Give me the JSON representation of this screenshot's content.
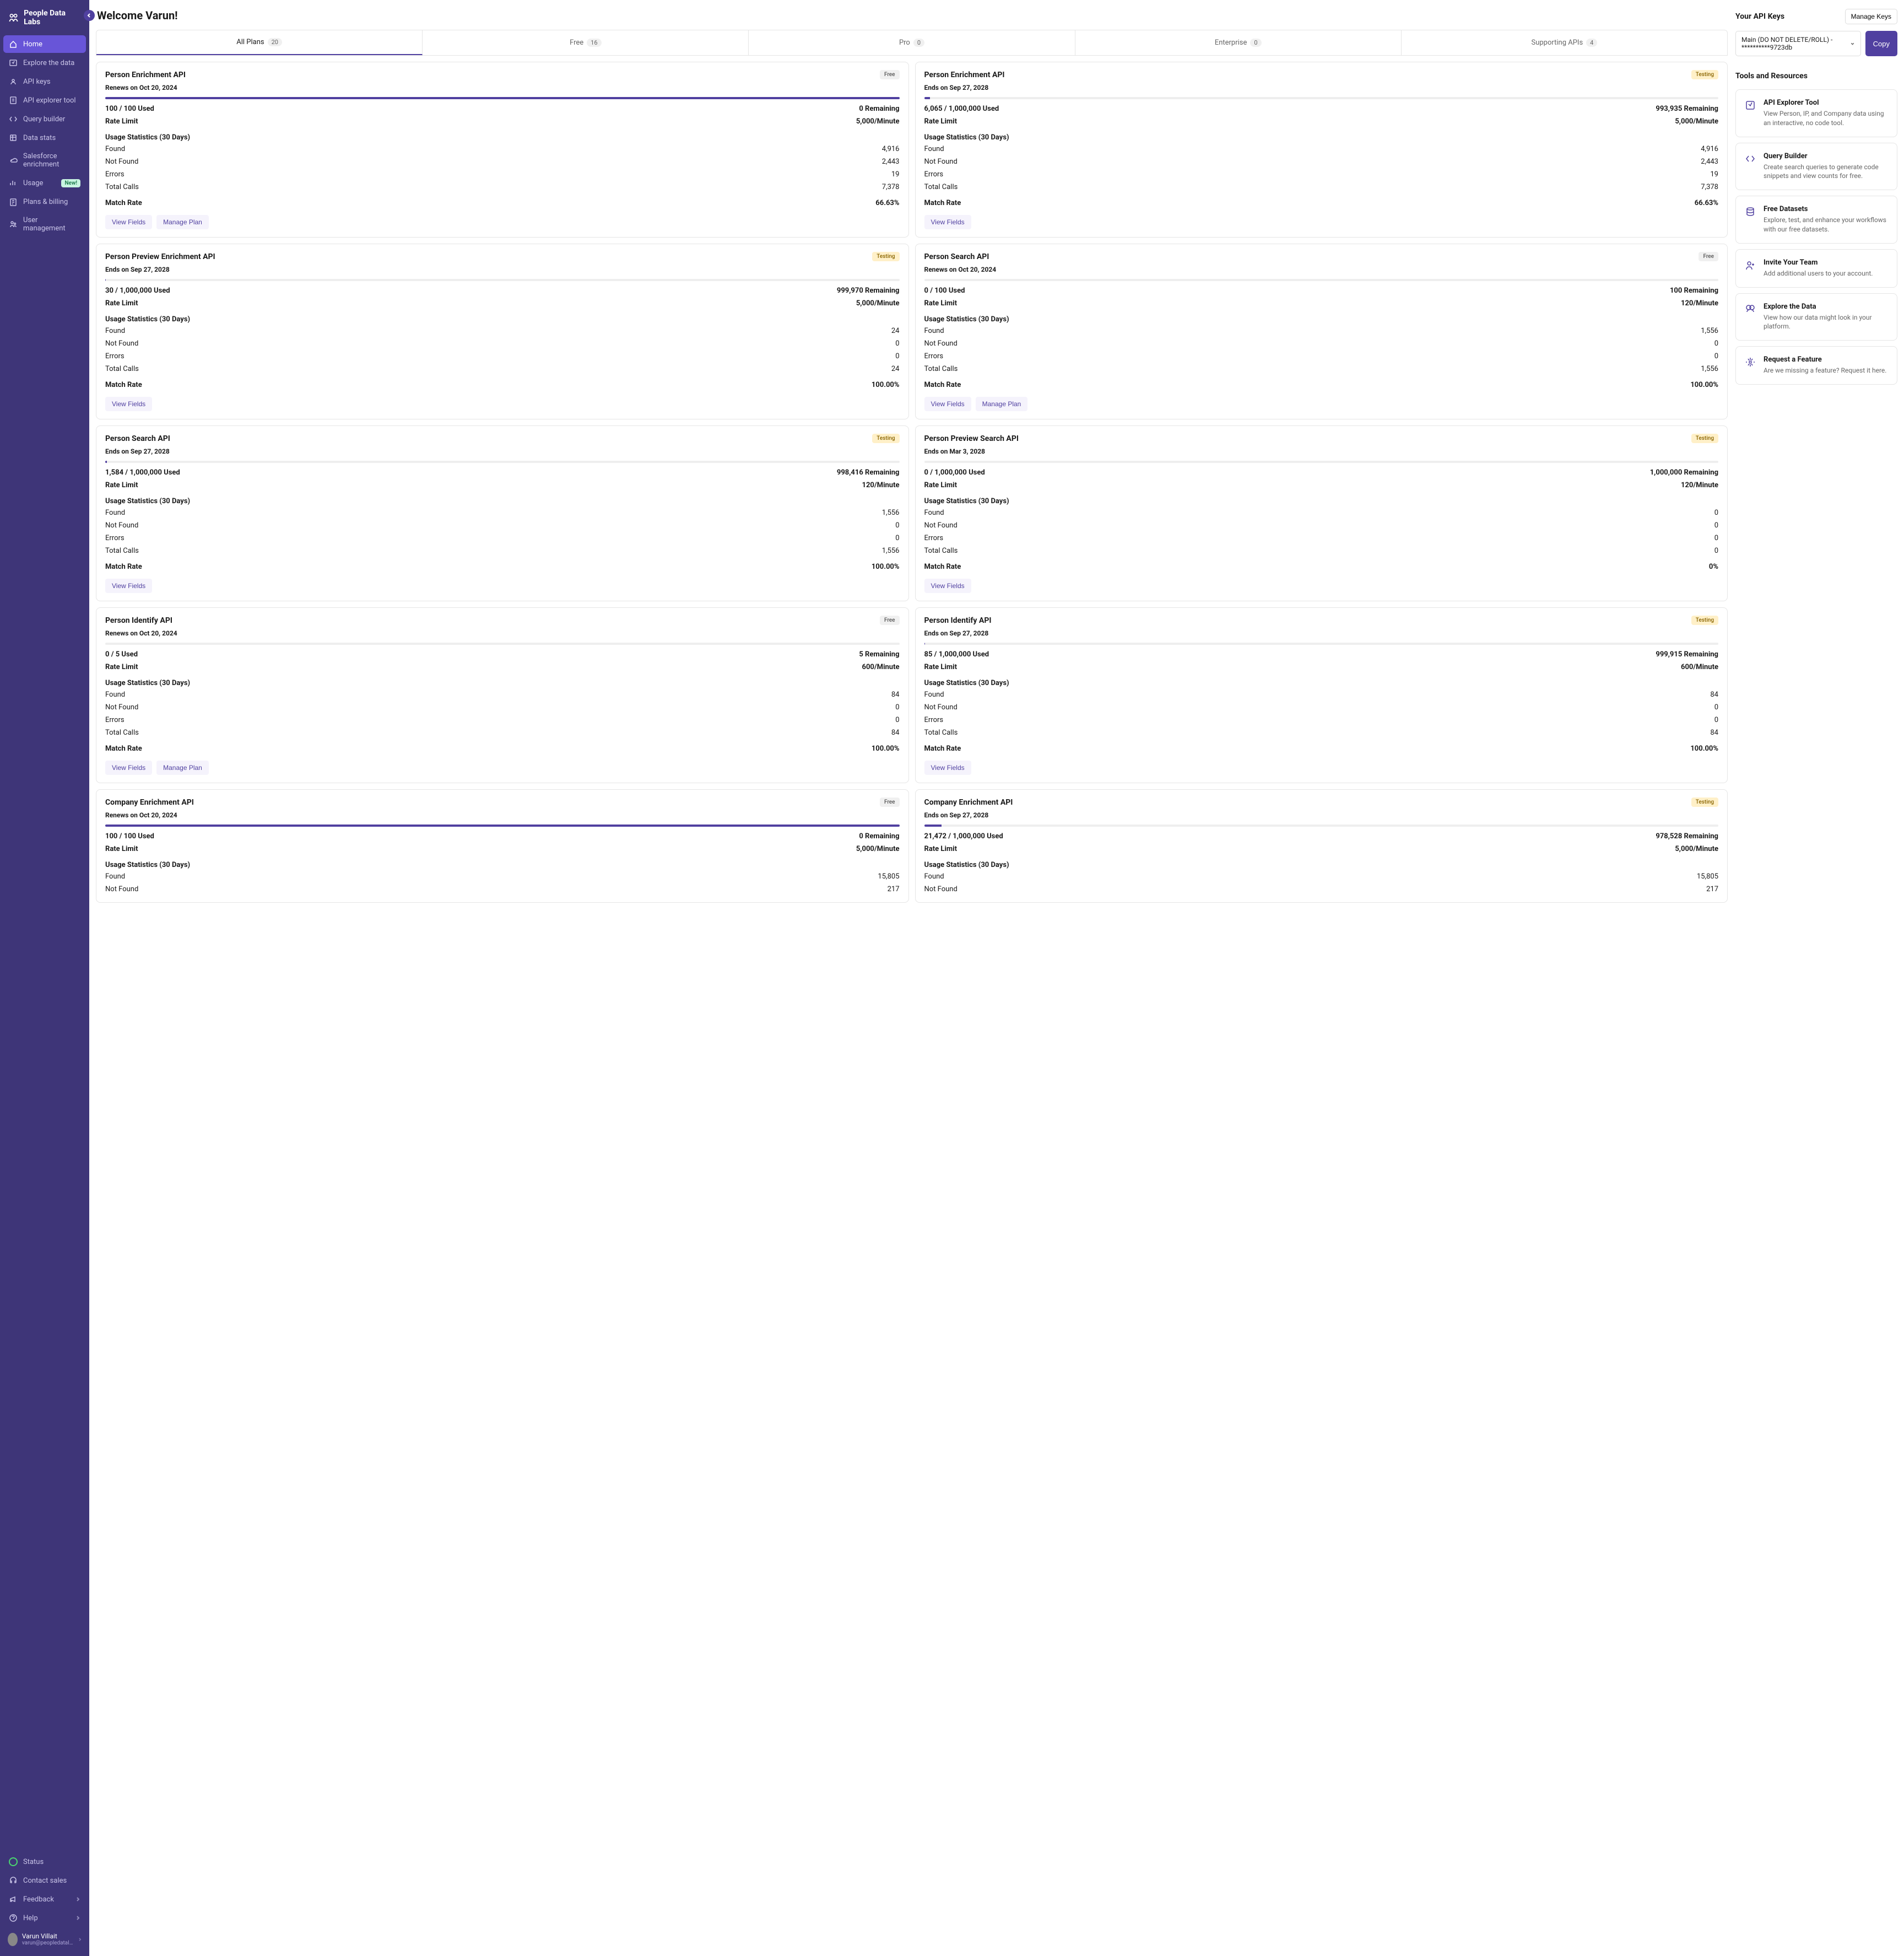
{
  "brand": "People Data Labs",
  "welcome": "Welcome Varun!",
  "sidebar": {
    "nav": [
      {
        "label": "Home",
        "active": true
      },
      {
        "label": "Explore the data"
      },
      {
        "label": "API keys"
      },
      {
        "label": "API explorer tool"
      },
      {
        "label": "Query builder"
      },
      {
        "label": "Data stats"
      },
      {
        "label": "Salesforce enrichment"
      },
      {
        "label": "Usage",
        "badge": "New!"
      },
      {
        "label": "Plans & billing"
      },
      {
        "label": "User management"
      }
    ],
    "footer": [
      {
        "label": "Status"
      },
      {
        "label": "Contact sales"
      },
      {
        "label": "Feedback",
        "chevron": true
      },
      {
        "label": "Help",
        "chevron": true
      }
    ],
    "user": {
      "name": "Varun Villait",
      "email": "varun@peopledatalabs.com"
    }
  },
  "tabs": [
    {
      "label": "All Plans",
      "count": "20",
      "active": true
    },
    {
      "label": "Free",
      "count": "16"
    },
    {
      "label": "Pro",
      "count": "0"
    },
    {
      "label": "Enterprise",
      "count": "0"
    },
    {
      "label": "Supporting APIs",
      "count": "4"
    }
  ],
  "labels": {
    "rate_limit": "Rate Limit",
    "usage_stats": "Usage Statistics (30 Days)",
    "found": "Found",
    "not_found": "Not Found",
    "errors": "Errors",
    "total_calls": "Total Calls",
    "match_rate": "Match Rate",
    "view_fields": "View Fields",
    "manage_plan": "Manage Plan"
  },
  "cards": [
    {
      "title": "Person Enrichment API",
      "badge": "Free",
      "renew": "Renews on Oct 20, 2024",
      "progress": 100,
      "used": "100 / 100 Used",
      "remaining": "0 Remaining",
      "rate": "5,000/Minute",
      "found": "4,916",
      "not_found": "2,443",
      "errors": "19",
      "total": "7,378",
      "match": "66.63%",
      "actions": [
        "view",
        "manage"
      ]
    },
    {
      "title": "Person Enrichment API",
      "badge": "Testing",
      "renew": "Ends on Sep 27, 2028",
      "progress": 0.7,
      "used": "6,065 / 1,000,000 Used",
      "remaining": "993,935 Remaining",
      "rate": "5,000/Minute",
      "found": "4,916",
      "not_found": "2,443",
      "errors": "19",
      "total": "7,378",
      "match": "66.63%",
      "actions": [
        "view"
      ]
    },
    {
      "title": "Person Preview Enrichment API",
      "badge": "Testing",
      "renew": "Ends on Sep 27, 2028",
      "progress": 0.1,
      "used": "30 / 1,000,000 Used",
      "remaining": "999,970 Remaining",
      "rate": "5,000/Minute",
      "found": "24",
      "not_found": "0",
      "errors": "0",
      "total": "24",
      "match": "100.00%",
      "actions": [
        "view"
      ]
    },
    {
      "title": "Person Search API",
      "badge": "Free",
      "renew": "Renews on Oct 20, 2024",
      "progress": 0,
      "used": "0 / 100 Used",
      "remaining": "100 Remaining",
      "rate": "120/Minute",
      "found": "1,556",
      "not_found": "0",
      "errors": "0",
      "total": "1,556",
      "match": "100.00%",
      "actions": [
        "view",
        "manage"
      ]
    },
    {
      "title": "Person Search API",
      "badge": "Testing",
      "renew": "Ends on Sep 27, 2028",
      "progress": 0.2,
      "used": "1,584 / 1,000,000 Used",
      "remaining": "998,416 Remaining",
      "rate": "120/Minute",
      "found": "1,556",
      "not_found": "0",
      "errors": "0",
      "total": "1,556",
      "match": "100.00%",
      "actions": [
        "view"
      ]
    },
    {
      "title": "Person Preview Search API",
      "badge": "Testing",
      "renew": "Ends on Mar 3, 2028",
      "progress": 0,
      "used": "0 / 1,000,000 Used",
      "remaining": "1,000,000 Remaining",
      "rate": "120/Minute",
      "found": "0",
      "not_found": "0",
      "errors": "0",
      "total": "0",
      "match": "0%",
      "actions": [
        "view"
      ]
    },
    {
      "title": "Person Identify API",
      "badge": "Free",
      "renew": "Renews on Oct 20, 2024",
      "progress": 0,
      "used": "0 / 5 Used",
      "remaining": "5 Remaining",
      "rate": "600/Minute",
      "found": "84",
      "not_found": "0",
      "errors": "0",
      "total": "84",
      "match": "100.00%",
      "actions": [
        "view",
        "manage"
      ]
    },
    {
      "title": "Person Identify API",
      "badge": "Testing",
      "renew": "Ends on Sep 27, 2028",
      "progress": 0.1,
      "used": "85 / 1,000,000 Used",
      "remaining": "999,915 Remaining",
      "rate": "600/Minute",
      "found": "84",
      "not_found": "0",
      "errors": "0",
      "total": "84",
      "match": "100.00%",
      "actions": [
        "view"
      ]
    },
    {
      "title": "Company Enrichment API",
      "badge": "Free",
      "renew": "Renews on Oct 20, 2024",
      "progress": 100,
      "used": "100 / 100 Used",
      "remaining": "0 Remaining",
      "rate": "5,000/Minute",
      "found": "15,805",
      "not_found": "217",
      "errors": "",
      "total": "",
      "match": "",
      "actions": [],
      "truncated": true
    },
    {
      "title": "Company Enrichment API",
      "badge": "Testing",
      "renew": "Ends on Sep 27, 2028",
      "progress": 2.2,
      "used": "21,472 / 1,000,000 Used",
      "remaining": "978,528 Remaining",
      "rate": "5,000/Minute",
      "found": "15,805",
      "not_found": "217",
      "errors": "",
      "total": "",
      "match": "",
      "actions": [],
      "truncated": true
    }
  ],
  "api_keys": {
    "title": "Your API Keys",
    "manage": "Manage Keys",
    "selected": "Main (DO NOT DELETE/ROLL) - **********9723db",
    "copy": "Copy"
  },
  "resources_title": "Tools and Resources",
  "resources": [
    {
      "title": "API Explorer Tool",
      "desc": "View Person, IP, and Company data using an interactive, no code tool."
    },
    {
      "title": "Query Builder",
      "desc": "Create search queries to generate code snippets and view counts for free."
    },
    {
      "title": "Free Datasets",
      "desc": "Explore, test, and enhance your workflows with our free datasets."
    },
    {
      "title": "Invite Your Team",
      "desc": "Add additional users to your account."
    },
    {
      "title": "Explore the Data",
      "desc": "View how our data might look in your platform."
    },
    {
      "title": "Request a Feature",
      "desc": "Are we missing a feature? Request it here."
    }
  ]
}
